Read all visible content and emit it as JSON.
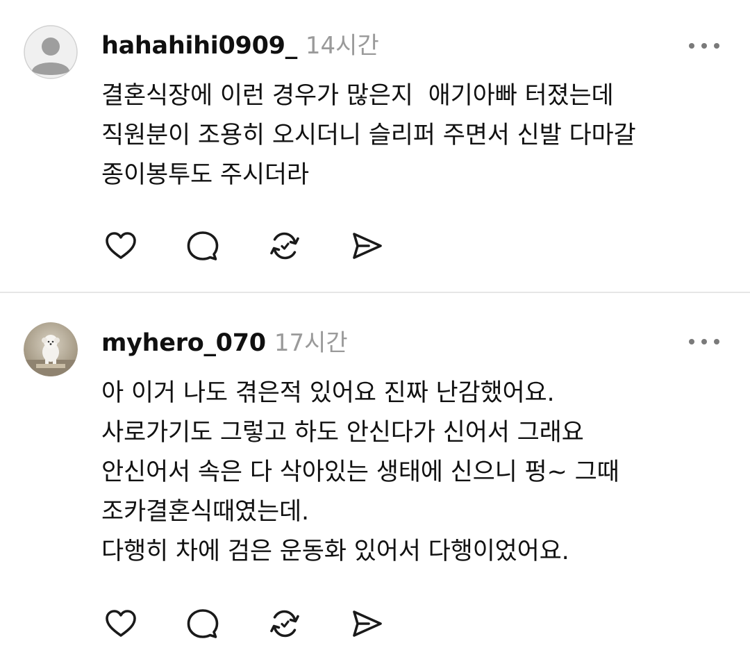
{
  "posts": [
    {
      "username": "hahahihi0909_",
      "time": "14시간",
      "lines": [
        "결혼식장에 이런 경우가 많은지  애기아빠 터졌는데",
        "직원분이 조용히 오시더니 슬리퍼 주면서 신발 다마갈",
        "종이봉투도 주시더라"
      ],
      "avatar_icon": "default-profile-icon"
    },
    {
      "username": "myhero_070",
      "time": "17시간",
      "lines": [
        "아 이거 나도 겪은적 있어요 진짜 난감했어요.",
        "사로가기도 그렇고 하도 안신다가 신어서 그래요",
        "안신어서 속은 다 삭아있는 생태에 신으니 펑~ 그때",
        "조카결혼식때였는데.",
        "다행히 차에 검은 운동화 있어서 다행이었어요."
      ],
      "avatar_icon": "dog-photo-avatar"
    }
  ],
  "actions": [
    "heart-icon",
    "comment-icon",
    "repost-icon",
    "share-icon"
  ],
  "colors": {
    "text": "#111111",
    "muted": "#9a9a9a",
    "icon": "#1a1a1a",
    "divider": "#e6e6e6"
  }
}
